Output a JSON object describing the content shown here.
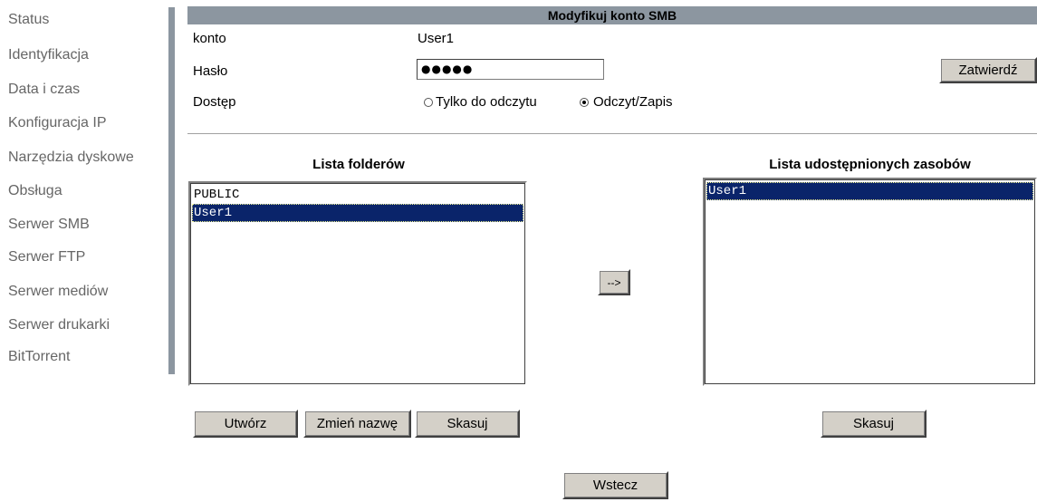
{
  "sidebar": {
    "items": [
      {
        "label": "Status"
      },
      {
        "label": "Identyfikacja"
      },
      {
        "label": "Data i czas"
      },
      {
        "label": "Konfiguracja IP"
      },
      {
        "label": "Narzędzia dyskowe"
      },
      {
        "label": "Obsługa"
      },
      {
        "label": "Serwer SMB"
      },
      {
        "label": "Serwer FTP"
      },
      {
        "label": "Serwer mediów"
      },
      {
        "label": "Serwer drukarki"
      },
      {
        "label": "BitTorrent"
      }
    ]
  },
  "header": {
    "title": "Modyfikuj konto SMB"
  },
  "form": {
    "account_label": "konto",
    "account_value": "User1",
    "password_label": "Hasło",
    "password_value": "●●●●●",
    "access_label": "Dostęp",
    "access_options": [
      {
        "label": "Tylko do odczytu",
        "checked": false
      },
      {
        "label": "Odczyt/Zapis",
        "checked": true
      }
    ],
    "confirm_button": "Zatwierdź"
  },
  "folders": {
    "title": "Lista folderów",
    "items": [
      "PUBLIC",
      "User1"
    ],
    "selected": "User1",
    "buttons": {
      "create": "Utwórz",
      "rename": "Zmień nazwę",
      "delete": "Skasuj"
    }
  },
  "move_button": "-->",
  "shares": {
    "title": "Lista udostępnionych zasobów",
    "items": [
      "User1"
    ],
    "selected": "User1",
    "delete_button": "Skasuj"
  },
  "back_button": "Wstecz",
  "colors": {
    "header_bg": "#8c96a0",
    "selection": "#0a246a",
    "nav_text": "#666666",
    "button_face": "#d4d0c8"
  }
}
